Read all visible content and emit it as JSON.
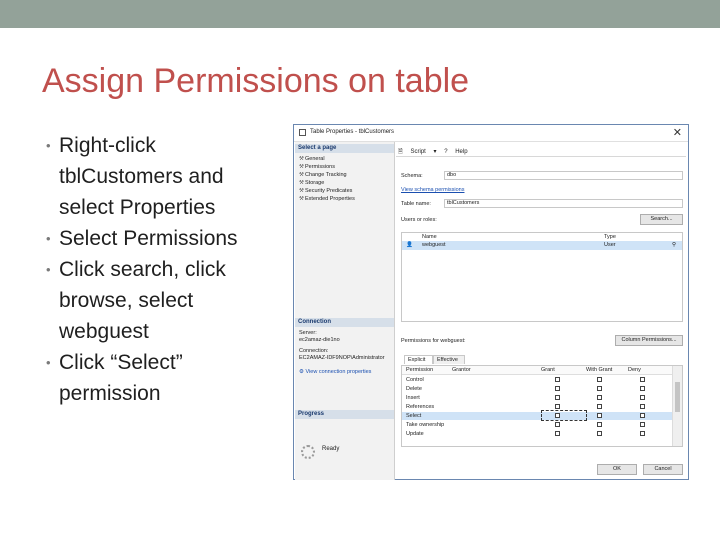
{
  "slide": {
    "title": "Assign Permissions on table",
    "bullets": [
      {
        "lines": [
          "Right-click",
          "tblCustomers and",
          "select Properties"
        ]
      },
      {
        "lines": [
          "Select Permissions"
        ]
      },
      {
        "lines": [
          "Click search, click",
          "browse, select",
          "webguest"
        ]
      },
      {
        "lines": [
          "Click “Select”",
          "permission"
        ]
      }
    ]
  },
  "dialog": {
    "title": "Table Properties - tblCustomers",
    "close": "✕",
    "select_page_header": "Select a page",
    "pages": [
      "General",
      "Permissions",
      "Change Tracking",
      "Storage",
      "Security Predicates",
      "Extended Properties"
    ],
    "connection_header": "Connection",
    "server_label": "Server:",
    "server_value": "ec2amaz-die1no",
    "connection_label": "Connection:",
    "connection_value": "EC2AMAZ-IDF9NOP\\Administrator",
    "view_conn_link": "View connection properties",
    "progress_header": "Progress",
    "progress_status": "Ready",
    "toolbar": {
      "script": "Script",
      "help": "Help"
    },
    "schema_label": "Schema:",
    "schema_value": "dbo",
    "view_schema_link": "View schema permissions",
    "table_name_label": "Table name:",
    "table_name_value": "tblCustomers",
    "users_roles_label": "Users or roles:",
    "search_button": "Search...",
    "users_grid": {
      "headers": [
        "Name",
        "Type"
      ],
      "rows": [
        {
          "name": "webguest",
          "type": "User"
        }
      ]
    },
    "permissions_for_label": "Permissions for webguest:",
    "column_permissions_button": "Column Permissions...",
    "tabs": [
      "Explicit",
      "Effective"
    ],
    "perm_headers": [
      "Permission",
      "Grantor",
      "Grant",
      "With Grant",
      "Deny"
    ],
    "permissions": [
      "Control",
      "Delete",
      "Insert",
      "References",
      "Select",
      "Take ownership",
      "Update"
    ],
    "selected_permission": "Select",
    "ok_button": "OK",
    "cancel_button": "Cancel"
  },
  "colors": {
    "title": "#c0504d",
    "topbar": "#93a299",
    "selection": "#cfe3f7",
    "link": "#1a4fb0"
  }
}
